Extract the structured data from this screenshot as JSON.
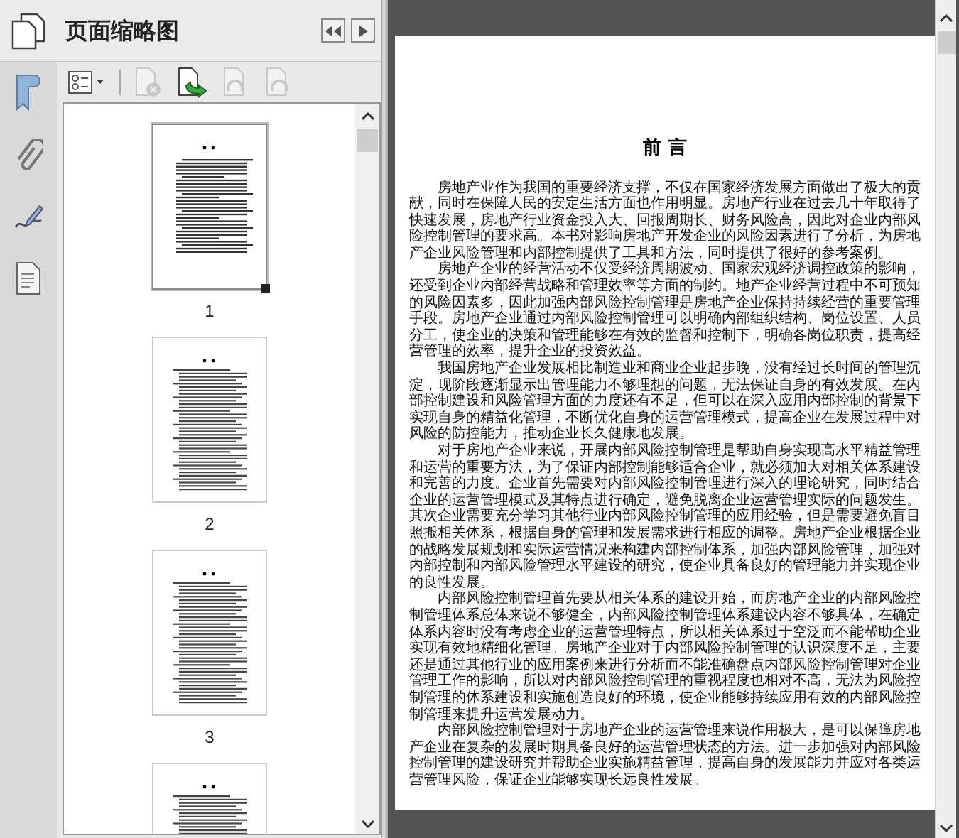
{
  "panel": {
    "title": "页面缩略图",
    "tools": [
      {
        "kind": "options",
        "disabled": false
      },
      {
        "kind": "delete",
        "disabled": true
      },
      {
        "kind": "extract",
        "disabled": false
      },
      {
        "kind": "rotate-left",
        "disabled": true
      },
      {
        "kind": "rotate-right",
        "disabled": true
      }
    ],
    "thumbnails": [
      {
        "label": "1",
        "selected": true,
        "kind": "text"
      },
      {
        "label": "2",
        "selected": false,
        "kind": "list"
      },
      {
        "label": "3",
        "selected": false,
        "kind": "list"
      },
      {
        "selected": false,
        "kind": "list"
      }
    ]
  },
  "document": {
    "title": "前 言",
    "paragraphs": [
      "房地产业作为我国的重要经济支撑，不仅在国家经济发展方面做出了极大的贡献，同时在保障人民的安定生活方面也作用明显。房地产行业在过去几十年取得了快速发展，房地产行业资金投入大、回报周期长、财务风险高，因此对企业内部风险控制管理的要求高。本书对影响房地产开发企业的风险因素进行了分析，为房地产企业风险管理和内部控制提供了工具和方法，同时提供了很好的参考案例。",
      "房地产企业的经营活动不仅受经济周期波动、国家宏观经济调控政策的影响，还受到企业内部经营战略和管理效率等方面的制约。地产企业经营过程中不可预知的风险因素多，因此加强内部风险控制管理是房地产企业保持持续经营的重要管理手段。房地产企业通过内部风险控制管理可以明确内部组织结构、岗位设置、人员分工，使企业的决策和管理能够在有效的监督和控制下，明确各岗位职责，提高经营管理的效率，提升企业的投资效益。",
      "我国房地产企业发展相比制造业和商业企业起步晚，没有经过长时间的管理沉淀，现阶段逐渐显示出管理能力不够理想的问题，无法保证自身的有效发展。在内部控制建设和风险管理方面的力度还有不足，但可以在深入应用内部控制的背景下实现自身的精益化管理，不断优化自身的运营管理模式，提高企业在发展过程中对风险的防控能力，推动企业长久健康地发展。",
      "对于房地产企业来说，开展内部风险控制管理是帮助自身实现高水平精益管理和运营的重要方法，为了保证内部控制能够适合企业，就必须加大对相关体系建设和完善的力度。企业首先需要对内部风险控制管理进行深入的理论研究，同时结合企业的运营管理模式及其特点进行确定，避免脱离企业运营管理实际的问题发生。其次企业需要充分学习其他行业内部风险控制管理的应用经验，但是需要避免盲目照搬相关体系，根据自身的管理和发展需求进行相应的调整。房地产企业根据企业的战略发展规划和实际运营情况来构建内部控制体系，加强内部风险管理，加强对内部控制和内部风险管理水平建设的研究，使企业具备良好的管理能力并实现企业的良性发展。",
      "内部风险控制管理首先要从相关体系的建设开始，而房地产企业的内部风险控制管理体系总体来说不够健全，内部风险控制管理体系建设内容不够具体，在确定体系内容时没有考虑企业的运营管理特点，所以相关体系过于空泛而不能帮助企业实现有效地精细化管理。房地产企业对于内部风险控制管理的认识深度不足，主要还是通过其他行业的应用案例来进行分析而不能准确盘点内部风险控制管理对企业管理工作的影响，所以对内部风险控制管理的重视程度也相对不高，无法为风险控制管理的体系建设和实施创造良好的环境，使企业能够持续应用有效的内部风险控制管理来提升运营发展动力。",
      "内部风险控制管理对于房地产企业的运营管理来说作用极大，是可以保障房地产企业在复杂的发展时期具备良好的运营管理状态的方法。进一步加强对内部风险控制管理的建设研究并帮助企业实施精益管理，提高自身的发展能力并应对各类运营管理风险，保证企业能够实现长远良性发展。"
    ]
  }
}
